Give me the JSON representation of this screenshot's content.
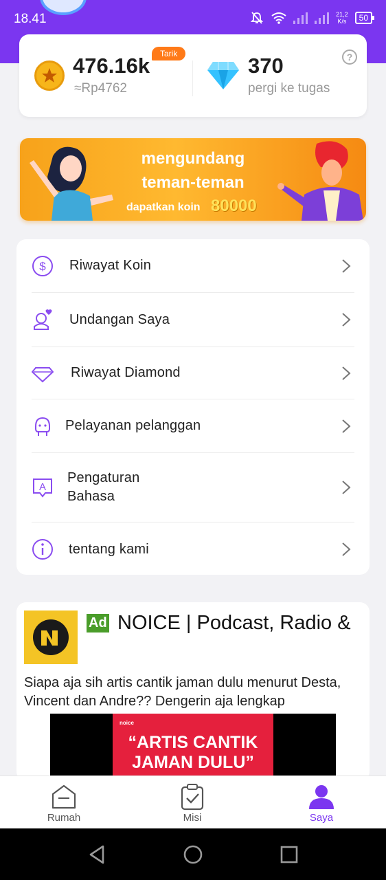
{
  "status_bar": {
    "time": "18.41",
    "net_speed_top": "21,2",
    "net_speed_unit": "K/s",
    "battery": "50"
  },
  "balance": {
    "coins": "476.16k",
    "coins_value": "≈Rp4762",
    "withdraw_badge": "Tarik",
    "diamonds": "370",
    "diamond_link": "pergi ke tugas"
  },
  "banner": {
    "line1": "mengundang",
    "line2": "teman-teman",
    "sub": "dapatkan koin",
    "amount": "80000"
  },
  "menu": {
    "items": [
      {
        "label": "Riwayat Koin",
        "icon": "dollar-circle-icon"
      },
      {
        "label": "Undangan Saya",
        "icon": "user-heart-icon"
      },
      {
        "label": "Riwayat Diamond",
        "icon": "diamond-outline-icon"
      },
      {
        "label": "Pelayanan pelanggan",
        "icon": "headset-icon"
      },
      {
        "label": "Pengaturan\nBahasa",
        "icon": "language-icon"
      },
      {
        "label": "tentang kami",
        "icon": "info-icon"
      }
    ]
  },
  "ad": {
    "badge": "Ad",
    "title": "NOICE | Podcast, Radio &",
    "description": "Siapa aja sih artis cantik jaman dulu menurut Desta, Vincent dan Andre?? Dengerin aja lengkap",
    "media_brand": "noice",
    "media_text": "“ARTIS CANTIK JAMAN DULU”"
  },
  "tabs": [
    {
      "label": "Rumah",
      "icon": "home-icon",
      "active": false
    },
    {
      "label": "Misi",
      "icon": "clipboard-check-icon",
      "active": false
    },
    {
      "label": "Saya",
      "icon": "user-icon",
      "active": true
    }
  ],
  "colors": {
    "primary": "#7b36f0",
    "accent_orange": "#ff7a18",
    "ad_green": "#4a9d2a",
    "ad_red": "#e5203d"
  }
}
